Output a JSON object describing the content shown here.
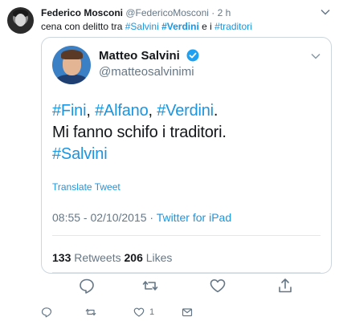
{
  "tweet": {
    "author_name": "Federico Mosconi",
    "author_handle": "@FedericoMosconi",
    "separator": " · ",
    "time": "2 h",
    "text_prefix": "cena con delitto tra ",
    "mention1": "#Salvini",
    "space1": " ",
    "mention2": "#Verdini",
    "text_mid": " e i ",
    "mention3": "#traditori"
  },
  "quoted": {
    "name": "Matteo Salvini",
    "handle": "@matteosalvinimi",
    "line1": {
      "tag1": "#Fini",
      "sep1": ", ",
      "tag2": "#Alfano",
      "sep2": ", ",
      "tag3": "#Verdini",
      "end": "."
    },
    "line2": "Mi fanno schifo i traditori.",
    "line3": "#Salvini",
    "translate": "Translate Tweet",
    "timestamp": "08:55 - 02/10/2015 · ",
    "source": "Twitter for iPad",
    "retweets_count": "133",
    "retweets_label": " Retweets ",
    "likes_count": "206",
    "likes_label": " Likes"
  },
  "actions": {
    "like_count": "1"
  },
  "icons": {
    "reply": "reply-icon",
    "retweet": "retweet-icon",
    "like": "heart-icon",
    "share": "share-icon",
    "dm": "envelope-icon",
    "verified": "verified-badge-icon",
    "menu": "chevron-down-icon"
  },
  "colors": {
    "link": "#1b95e0",
    "muted": "#657786",
    "border": "#ccd6dd"
  }
}
